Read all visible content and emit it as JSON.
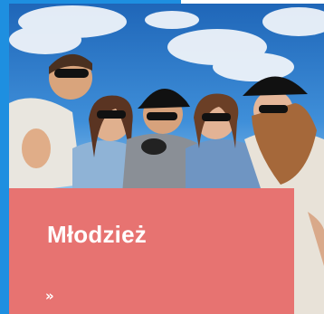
{
  "card": {
    "title": "Młodzież",
    "more_link_label": "»",
    "more_icon": "double-chevron-right-icon"
  },
  "colors": {
    "accent": "#1e8fe0",
    "panel": "#e77371",
    "text": "#ffffff"
  }
}
